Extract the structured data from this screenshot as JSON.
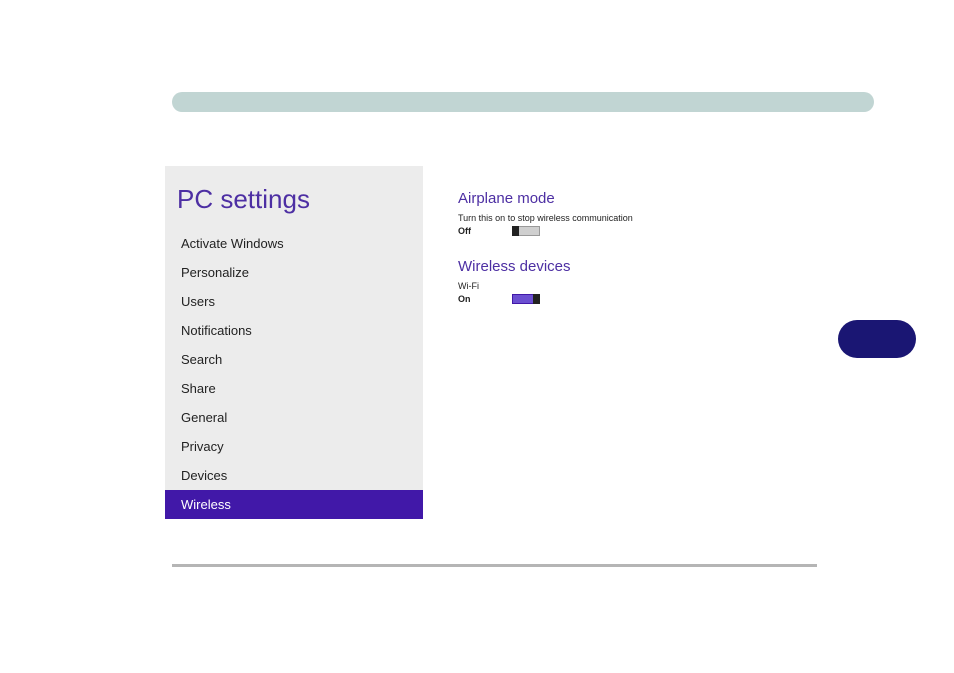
{
  "colors": {
    "accent": "#4118a8",
    "accentText": "#4d2fa3",
    "barBg": "#c1d5d3",
    "sidebarBg": "#ececec",
    "sideButton": "#1a1673"
  },
  "sidebar": {
    "title": "PC settings",
    "items": [
      {
        "label": "Activate Windows",
        "selected": false
      },
      {
        "label": "Personalize",
        "selected": false
      },
      {
        "label": "Users",
        "selected": false
      },
      {
        "label": "Notifications",
        "selected": false
      },
      {
        "label": "Search",
        "selected": false
      },
      {
        "label": "Share",
        "selected": false
      },
      {
        "label": "General",
        "selected": false
      },
      {
        "label": "Privacy",
        "selected": false
      },
      {
        "label": "Devices",
        "selected": false
      },
      {
        "label": "Wireless",
        "selected": true
      }
    ]
  },
  "content": {
    "airplane": {
      "title": "Airplane mode",
      "desc": "Turn this on to stop wireless communication",
      "stateLabel": "Off",
      "state": "off"
    },
    "wireless": {
      "title": "Wireless devices",
      "deviceLabel": "Wi-Fi",
      "stateLabel": "On",
      "state": "on"
    }
  }
}
